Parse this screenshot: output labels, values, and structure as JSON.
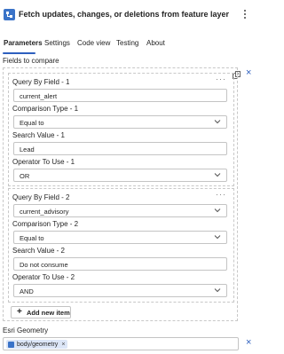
{
  "header": {
    "title": "Fetch updates, changes, or deletions from feature layer",
    "app_icon": "workflow-action-icon",
    "more_icon": "more-vertical-icon"
  },
  "tabs": [
    {
      "label": "Parameters",
      "active": true
    },
    {
      "label": "Settings"
    },
    {
      "label": "Code view"
    },
    {
      "label": "Testing"
    },
    {
      "label": "About"
    }
  ],
  "fields_to_compare": {
    "label": "Fields to compare",
    "groups": [
      {
        "query_by_field_label": "Query By Field - 1",
        "query_by_field_value": "current_alert",
        "comparison_type_label": "Comparison Type - 1",
        "comparison_type_value": "Equal to",
        "search_value_label": "Search Value - 1",
        "search_value_value": "Lead",
        "operator_label": "Operator To Use - 1",
        "operator_value": "OR"
      },
      {
        "query_by_field_label": "Query By Field - 2",
        "query_by_field_value": "current_advisory",
        "comparison_type_label": "Comparison Type - 2",
        "comparison_type_value": "Equal to",
        "search_value_label": "Search Value - 2",
        "search_value_value": "Do not consume",
        "operator_label": "Operator To Use - 2",
        "operator_value": "AND"
      }
    ],
    "add_button_label": "Add new item"
  },
  "esri_geometry": {
    "label": "Esri Geometry",
    "token_label": "body/geometry",
    "token_remove": "×"
  },
  "close_glyph": "×",
  "dots_glyph": "···",
  "colors": {
    "accent": "#2d5fbe",
    "icon_blue": "#3a73c8",
    "token_bg": "#dce6f7"
  }
}
